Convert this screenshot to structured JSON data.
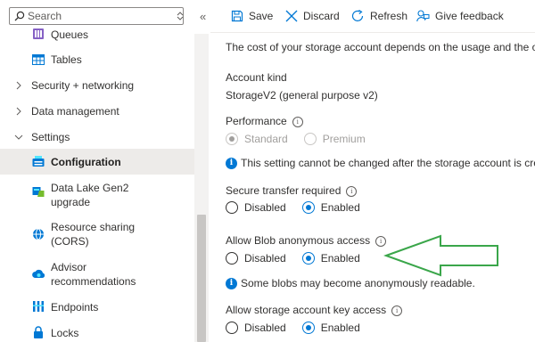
{
  "sidebar": {
    "search": {
      "placeholder": "Search",
      "value": ""
    },
    "items": [
      {
        "label": "Queues",
        "icon": "queues-icon",
        "kind": "sub"
      },
      {
        "label": "Tables",
        "icon": "tables-icon",
        "kind": "sub"
      },
      {
        "label": "Security + networking",
        "icon": "chevron-right-icon",
        "kind": "group"
      },
      {
        "label": "Data management",
        "icon": "chevron-right-icon",
        "kind": "group"
      },
      {
        "label": "Settings",
        "icon": "chevron-down-icon",
        "kind": "group"
      },
      {
        "label": "Configuration",
        "icon": "configuration-icon",
        "kind": "sub",
        "active": true
      },
      {
        "label": "Data Lake Gen2 upgrade",
        "line1": "Data Lake Gen2",
        "line2": "upgrade",
        "icon": "data-lake-icon",
        "kind": "sub"
      },
      {
        "label": "Resource sharing (CORS)",
        "line1": "Resource sharing",
        "line2": "(CORS)",
        "icon": "cors-icon",
        "kind": "sub"
      },
      {
        "label": "Advisor recommendations",
        "line1": "Advisor",
        "line2": "recommendations",
        "icon": "advisor-icon",
        "kind": "sub"
      },
      {
        "label": "Endpoints",
        "icon": "endpoints-icon",
        "kind": "sub"
      },
      {
        "label": "Locks",
        "icon": "lock-icon",
        "kind": "sub"
      }
    ]
  },
  "toolbar": {
    "save": "Save",
    "discard": "Discard",
    "refresh": "Refresh",
    "feedback": "Give feedback"
  },
  "main": {
    "intro": "The cost of your storage account depends on the usage and the op",
    "account_kind": {
      "label": "Account kind",
      "value": "StorageV2 (general purpose v2)"
    },
    "performance": {
      "label": "Performance",
      "options": [
        "Standard",
        "Premium"
      ],
      "selected": "Standard",
      "disabled": true,
      "note": "This setting cannot be changed after the storage account is crea"
    },
    "secure_transfer": {
      "label": "Secure transfer required",
      "options": [
        "Disabled",
        "Enabled"
      ],
      "selected": "Enabled"
    },
    "blob_anonymous": {
      "label": "Allow Blob anonymous access",
      "options": [
        "Disabled",
        "Enabled"
      ],
      "selected": "Enabled",
      "note": "Some blobs may become anonymously readable."
    },
    "key_access": {
      "label": "Allow storage account key access",
      "options": [
        "Disabled",
        "Enabled"
      ],
      "selected": "Enabled"
    }
  },
  "colors": {
    "accent": "#0078d4",
    "annotation_arrow": "#3aa64a"
  }
}
